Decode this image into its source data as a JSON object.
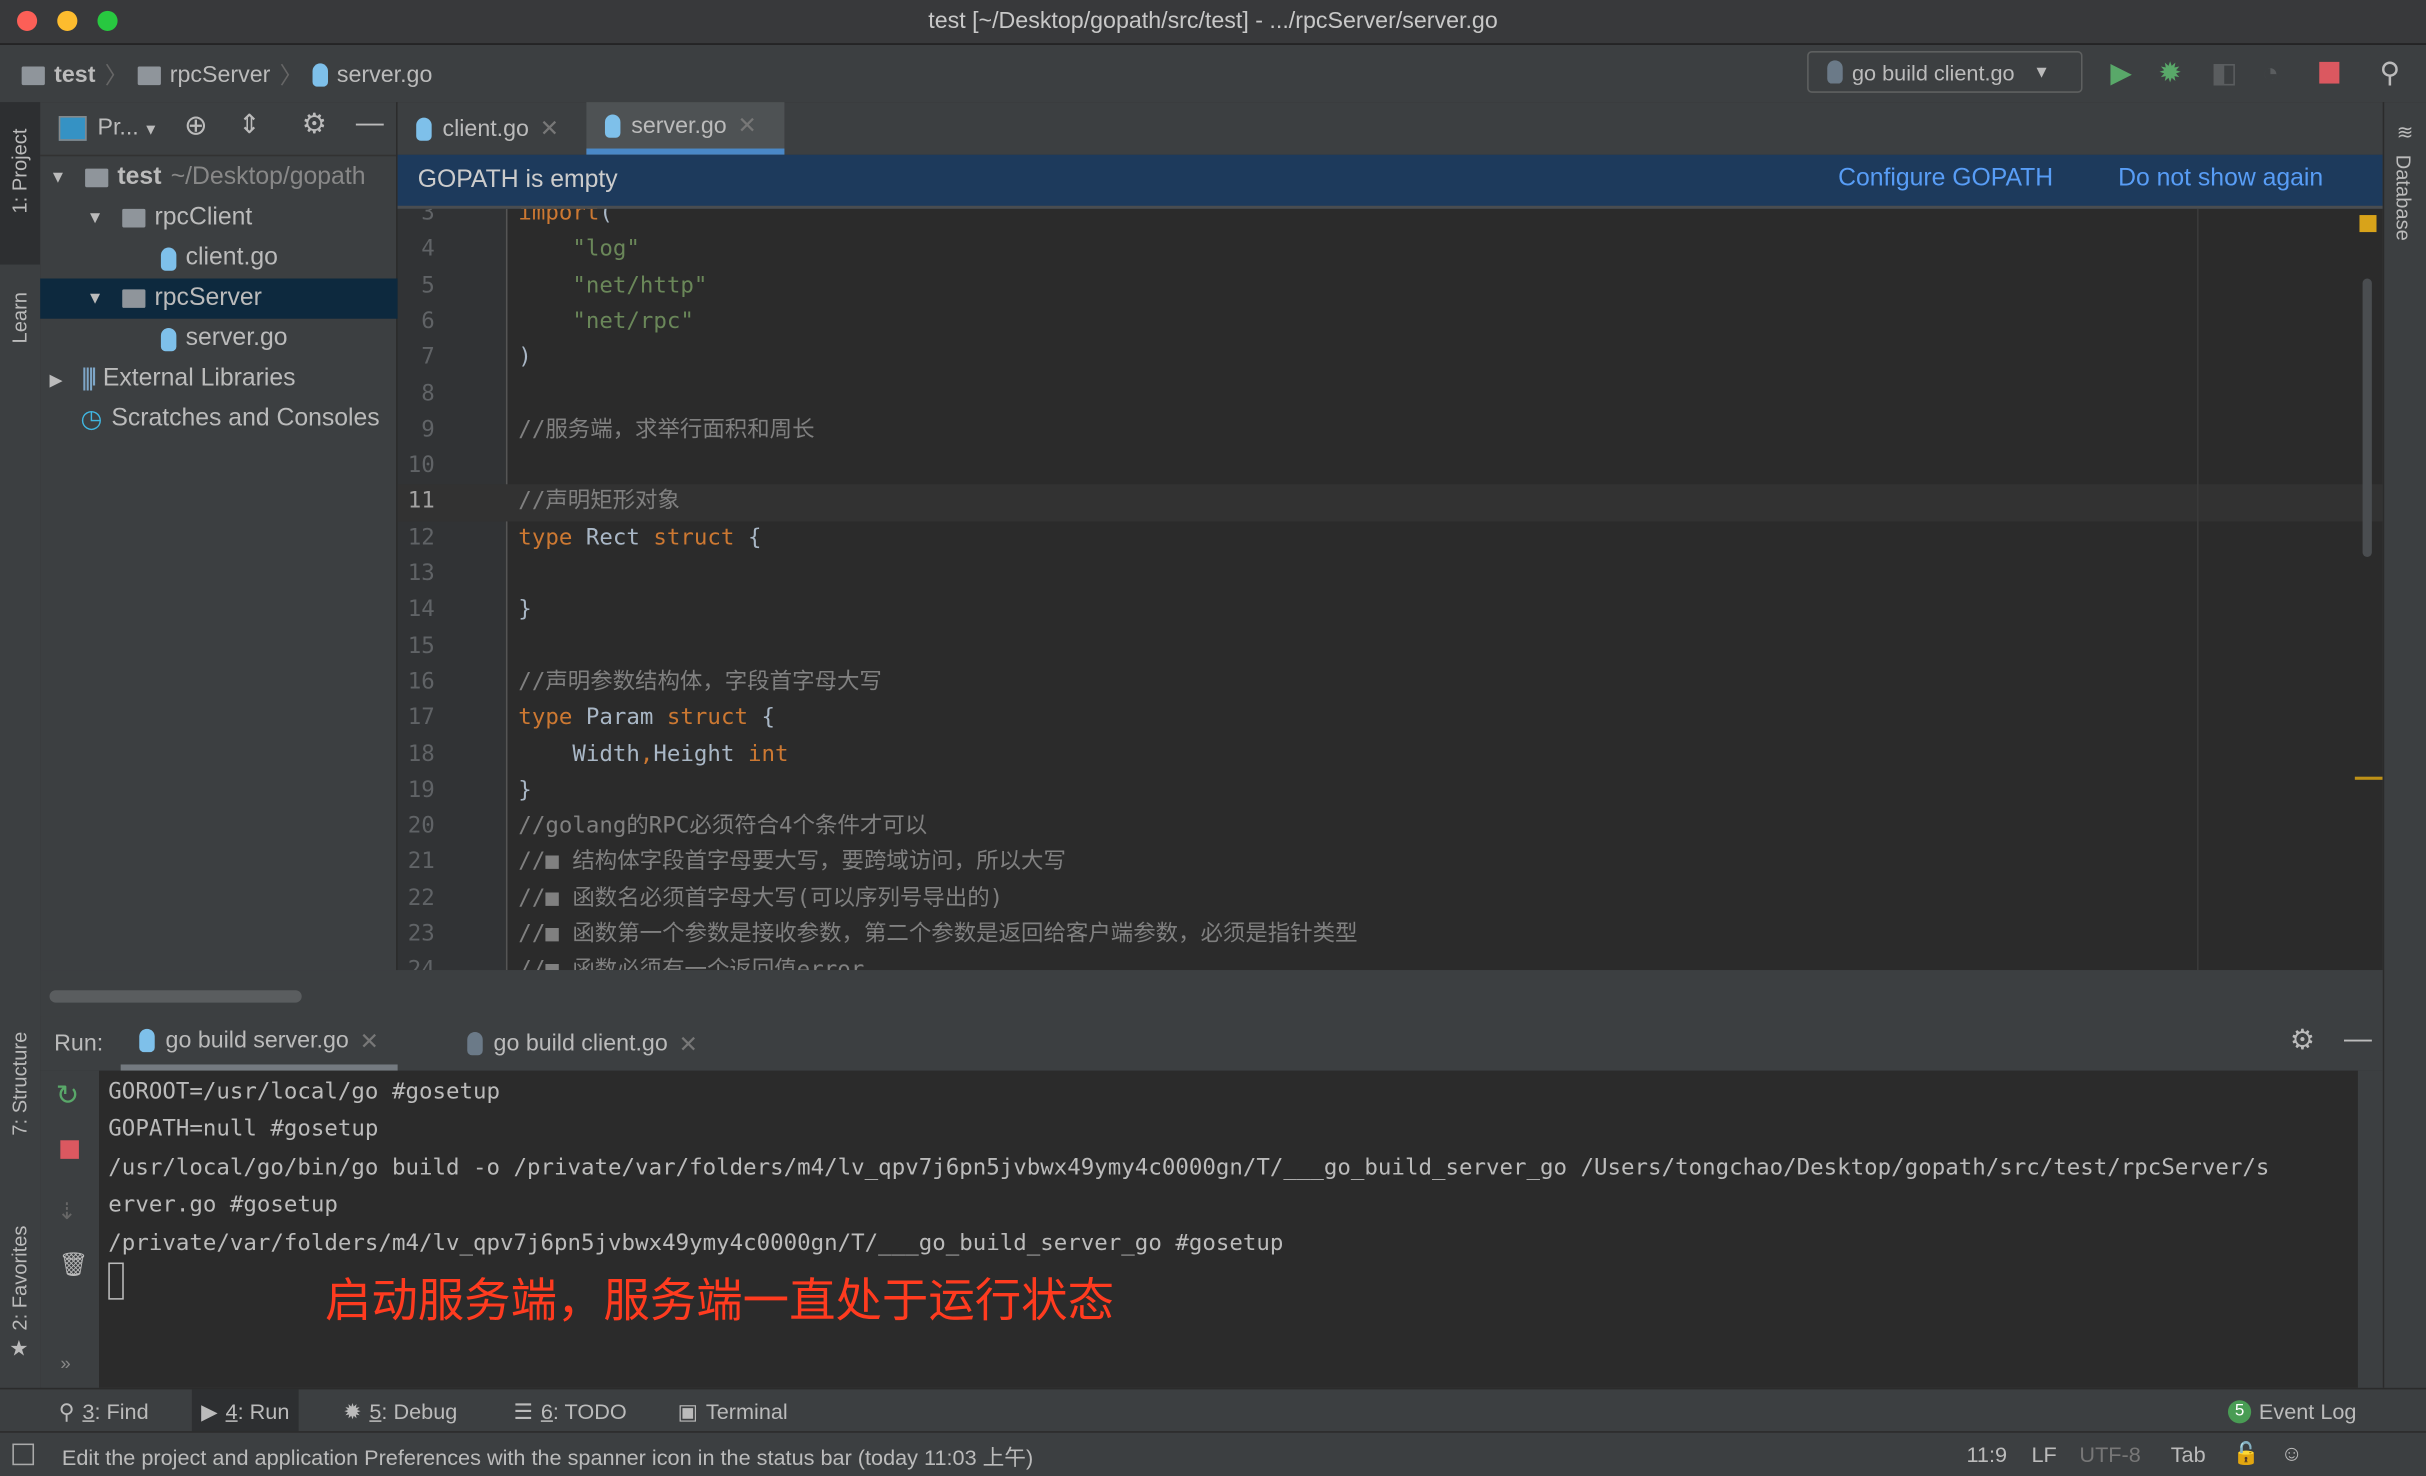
{
  "window": {
    "title": "test [~/Desktop/gopath/src/test] - .../rpcServer/server.go"
  },
  "breadcrumb": [
    "test",
    "rpcServer",
    "server.go"
  ],
  "run_config": {
    "label": "go build client.go"
  },
  "colors": {
    "accent": "#4a88c7",
    "notification_bg": "#1d3a5c",
    "link": "#589df6",
    "run_green": "#59a869",
    "stop_red": "#db5860",
    "annotation_red": "#ff3b1f"
  },
  "left_stripe": {
    "project": "1: Project",
    "learn": "Learn",
    "structure": "7: Structure",
    "favorites": "2: Favorites"
  },
  "right_stripe": {
    "database": "Database"
  },
  "project_panel": {
    "view_label": "Pr...",
    "tree": [
      {
        "label": "test",
        "hint": "~/Desktop/gopath",
        "icon": "folder-icon",
        "expanded": true
      },
      {
        "label": "rpcClient",
        "icon": "folder-icon",
        "expanded": true
      },
      {
        "label": "client.go",
        "icon": "go-file-icon"
      },
      {
        "label": "rpcServer",
        "icon": "folder-icon",
        "expanded": true,
        "selected": true
      },
      {
        "label": "server.go",
        "icon": "go-file-icon"
      },
      {
        "label": "External Libraries",
        "icon": "library-icon",
        "expanded": false
      },
      {
        "label": "Scratches and Consoles",
        "icon": "scratches-icon"
      }
    ]
  },
  "editor": {
    "tabs": [
      {
        "label": "client.go",
        "active": false
      },
      {
        "label": "server.go",
        "active": true
      }
    ],
    "notification": {
      "text": "GOPATH is empty",
      "configure": "Configure GOPATH",
      "dismiss": "Do not show again"
    },
    "current_line": 11,
    "lines": [
      {
        "n": "3",
        "parts": [
          [
            "kw",
            "import"
          ],
          [
            "",
            "("
          ]
        ]
      },
      {
        "n": "4",
        "parts": [
          [
            "",
            "    "
          ],
          [
            "str",
            "\"log\""
          ]
        ]
      },
      {
        "n": "5",
        "parts": [
          [
            "",
            "    "
          ],
          [
            "str",
            "\"net/http\""
          ]
        ]
      },
      {
        "n": "6",
        "parts": [
          [
            "",
            "    "
          ],
          [
            "str",
            "\"net/rpc\""
          ]
        ]
      },
      {
        "n": "7",
        "parts": [
          [
            "",
            ")"
          ]
        ]
      },
      {
        "n": "8",
        "parts": []
      },
      {
        "n": "9",
        "parts": [
          [
            "cm",
            "//服务端，求举行面积和周长"
          ]
        ]
      },
      {
        "n": "10",
        "parts": []
      },
      {
        "n": "11",
        "parts": [
          [
            "cm",
            "//声明矩形对象"
          ]
        ]
      },
      {
        "n": "12",
        "parts": [
          [
            "kw",
            "type "
          ],
          [
            "",
            "Rect "
          ],
          [
            "kw",
            "struct "
          ],
          [
            "",
            "{"
          ]
        ]
      },
      {
        "n": "13",
        "parts": []
      },
      {
        "n": "14",
        "parts": [
          [
            "",
            "}"
          ]
        ]
      },
      {
        "n": "15",
        "parts": []
      },
      {
        "n": "16",
        "parts": [
          [
            "cm",
            "//声明参数结构体，字段首字母大写"
          ]
        ]
      },
      {
        "n": "17",
        "parts": [
          [
            "kw",
            "type "
          ],
          [
            "",
            "Param "
          ],
          [
            "kw",
            "struct "
          ],
          [
            "",
            "{"
          ]
        ]
      },
      {
        "n": "18",
        "parts": [
          [
            "",
            "    Width"
          ],
          [
            "kw",
            ","
          ],
          [
            "",
            "Height "
          ],
          [
            "kw",
            "int"
          ]
        ]
      },
      {
        "n": "19",
        "parts": [
          [
            "",
            "}"
          ]
        ]
      },
      {
        "n": "20",
        "parts": [
          [
            "cm",
            "//golang的RPC必须符合4个条件才可以"
          ]
        ]
      },
      {
        "n": "21",
        "parts": [
          [
            "cm",
            "//■ 结构体字段首字母要大写，要跨域访问，所以大写"
          ]
        ]
      },
      {
        "n": "22",
        "parts": [
          [
            "cm",
            "//■ 函数名必须首字母大写(可以序列号导出的)"
          ]
        ]
      },
      {
        "n": "23",
        "parts": [
          [
            "cm",
            "//■ 函数第一个参数是接收参数，第二个参数是返回给客户端参数，必须是指针类型"
          ]
        ]
      },
      {
        "n": "24",
        "parts": [
          [
            "cm",
            "//■ 函数必须有一个返回值error"
          ]
        ]
      }
    ]
  },
  "run_panel": {
    "label": "Run:",
    "tabs": [
      {
        "label": "go build server.go",
        "active": true
      },
      {
        "label": "go build client.go",
        "active": false
      }
    ],
    "output": [
      "GOROOT=/usr/local/go #gosetup",
      "GOPATH=null #gosetup",
      "/usr/local/go/bin/go build -o /private/var/folders/m4/lv_qpv7j6pn5jvbwx49ymy4c0000gn/T/___go_build_server_go /Users/tongchao/Desktop/gopath/src/test/rpcServer/s",
      "erver.go #gosetup",
      "/private/var/folders/m4/lv_qpv7j6pn5jvbwx49ymy4c0000gn/T/___go_build_server_go #gosetup"
    ],
    "annotation": "启动服务端，服务端一直处于运行状态"
  },
  "tool_windows": [
    {
      "num": "3",
      "label": ": Find",
      "icon": "search-icon"
    },
    {
      "num": "4",
      "label": ": Run",
      "icon": "run-icon",
      "active": true
    },
    {
      "num": "5",
      "label": ": Debug",
      "icon": "bug-icon"
    },
    {
      "num": "6",
      "label": ": TODO",
      "icon": "list-icon"
    },
    {
      "num": "",
      "label": "Terminal",
      "icon": "terminal-icon"
    }
  ],
  "event_log": {
    "count": "5",
    "label": "Event Log"
  },
  "status": {
    "message": "Edit the project and application Preferences with the spanner icon in the status bar (today 11:03 上午)",
    "position": "11:9",
    "line_sep": "LF",
    "encoding": "UTF-8",
    "indent": "Tab"
  }
}
